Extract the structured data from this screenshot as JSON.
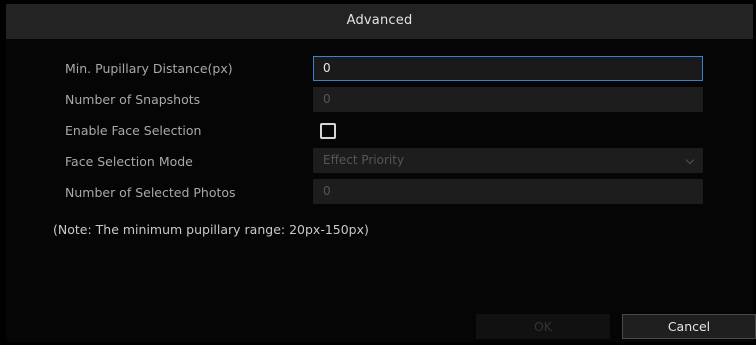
{
  "dialog": {
    "title": "Advanced",
    "fields": {
      "min_pupillary": {
        "label": "Min. Pupillary Distance(px)",
        "value": "0"
      },
      "num_snapshots": {
        "label": "Number of Snapshots",
        "value": "0"
      },
      "enable_face": {
        "label": "Enable Face Selection",
        "checked": false
      },
      "face_mode": {
        "label": "Face Selection Mode",
        "value": "Effect Priority"
      },
      "num_selected": {
        "label": "Number of Selected Photos",
        "value": "0"
      }
    },
    "note": "(Note: The minimum pupillary range: 20px-150px)",
    "buttons": {
      "ok": "OK",
      "cancel": "Cancel"
    }
  },
  "colors": {
    "accent_border": "#3d7fd1",
    "background": "#050505",
    "titlebar": "#232323"
  }
}
